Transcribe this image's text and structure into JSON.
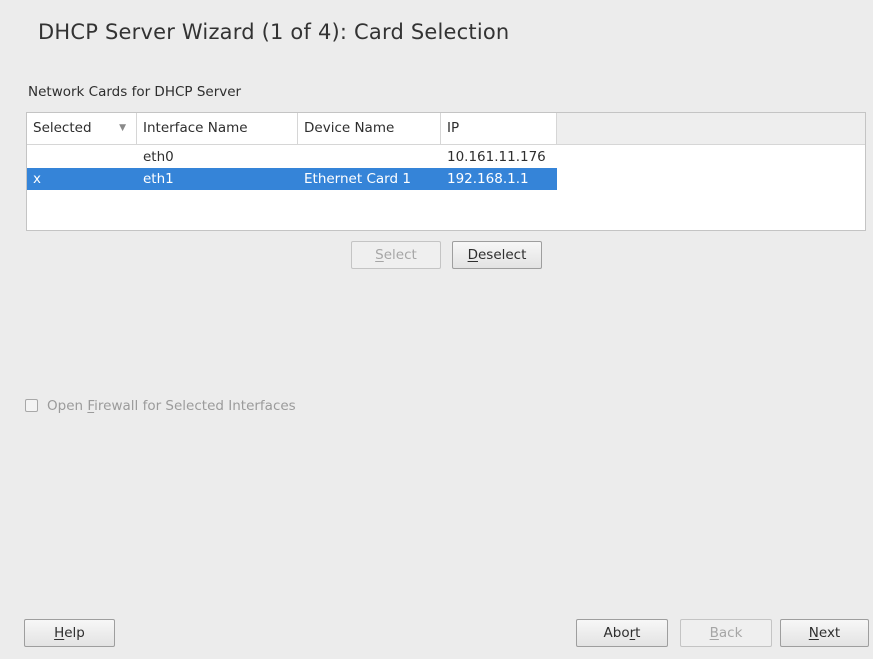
{
  "window": {
    "title": "DHCP Server Wizard (1 of 4): Card Selection"
  },
  "cards_section": {
    "label": "Network Cards for DHCP Server"
  },
  "table": {
    "columns": [
      "Selected",
      "Interface Name",
      "Device Name",
      "IP"
    ],
    "sort_column": "Selected",
    "rows": [
      {
        "selected": "",
        "interface": "eth0",
        "device": "",
        "ip": "10.161.11.176",
        "highlighted": false
      },
      {
        "selected": "x",
        "interface": "eth1",
        "device": "Ethernet Card 1",
        "ip": "192.168.1.1",
        "highlighted": true
      }
    ]
  },
  "actions": {
    "select": {
      "label": "Select",
      "mnemonic": "S",
      "rest": "elect",
      "enabled": false
    },
    "deselect": {
      "label": "Deselect",
      "mnemonic": "D",
      "rest": "eselect",
      "enabled": true
    }
  },
  "firewall": {
    "label_pre": "Open ",
    "label_mnemonic": "F",
    "label_rest": "irewall for Selected Interfaces",
    "checked": false,
    "enabled": false
  },
  "footer": {
    "help": {
      "mnemonic": "H",
      "rest": "elp"
    },
    "abort": {
      "pre": "Abo",
      "mnemonic": "r",
      "rest": "t"
    },
    "back": {
      "mnemonic": "B",
      "rest": "ack",
      "enabled": false
    },
    "next": {
      "mnemonic": "N",
      "rest": "ext"
    }
  },
  "colors": {
    "background": "#ececec",
    "selection": "#3584d8",
    "table_background": "#ffffff"
  }
}
